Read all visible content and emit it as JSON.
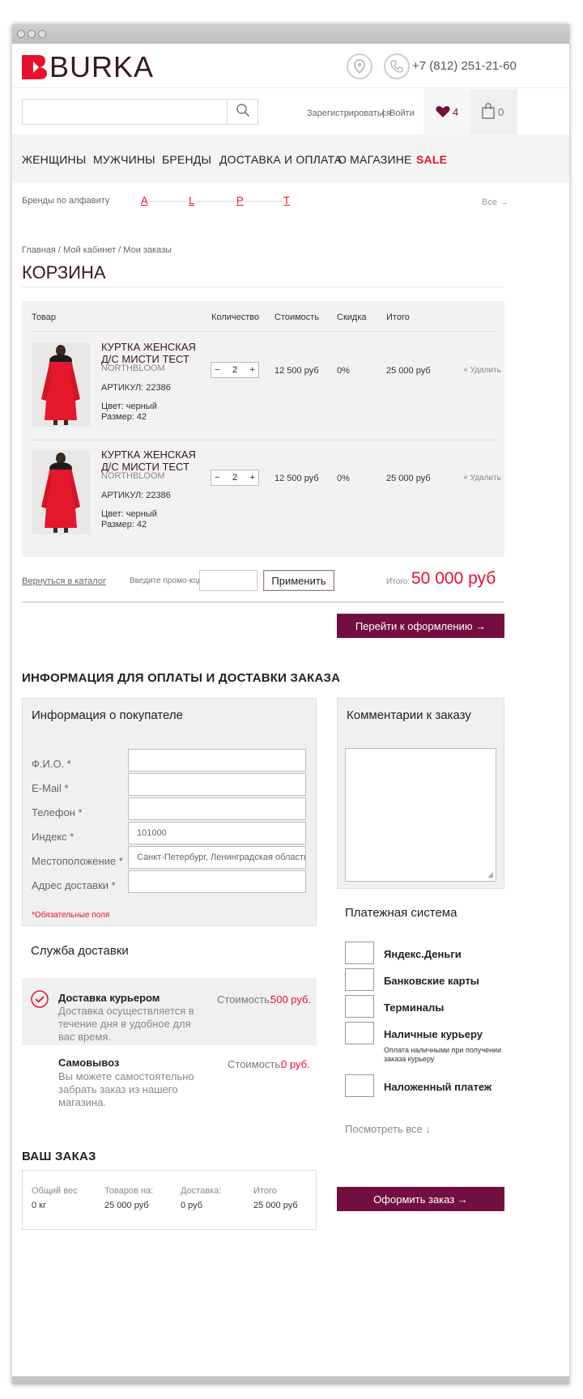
{
  "header": {
    "logo_text": "BURKA",
    "phone": "+7 (812) 251-21-60"
  },
  "topbar": {
    "search_placeholder": "",
    "register": "Зарегистрироваться",
    "separator": "|",
    "login": "Войти",
    "wishlist_count": "4",
    "cart_count": "0"
  },
  "nav": {
    "items": [
      "ЖЕНЩИНЫ",
      "МУЖЧИНЫ",
      "БРЕНДЫ",
      "ДОСТАВКА И ОПЛАТА",
      "О МАГАЗИНЕ"
    ],
    "sale": "SALE"
  },
  "brands_bar": {
    "label": "Бренды по алфавиту",
    "letters": [
      "A",
      "L",
      "P",
      "T"
    ],
    "all": "Все →"
  },
  "breadcrumbs": "Главная / Мой кабинет / Мои заказы",
  "page_title": "КОРЗИНА",
  "cart": {
    "headers": {
      "product": "Товар",
      "qty": "Количество",
      "price": "Стоимость",
      "discount": "Скидка",
      "total": "Итого"
    },
    "items": [
      {
        "name": "КУРТКА ЖЕНСКАЯ Д/С МИСТИ ТЕСТ",
        "brand": "NORTHBLOOM",
        "sku": "АРТИКУЛ: 22386",
        "color": "Цвет: черный",
        "size": "Размер: 42",
        "qty": "2",
        "price": "12 500 руб",
        "discount": "0%",
        "total": "25 000 руб",
        "remove": "× Удалить"
      },
      {
        "name": "КУРТКА ЖЕНСКАЯ Д/С МИСТИ ТЕСТ",
        "brand": "NORTHBLOOM",
        "sku": "АРТИКУЛ: 22386",
        "color": "Цвет: черный",
        "size": "Размер: 42",
        "qty": "2",
        "price": "12 500 руб",
        "discount": "0%",
        "total": "25 000 руб",
        "remove": "× Удалить"
      }
    ],
    "back_link": "Вернуться в каталог",
    "promo_label": "Введите промо-код",
    "promo_value": "",
    "apply": "Применить",
    "total_label": "Итого:",
    "total_value": "50 000 руб",
    "checkout": "Перейти к оформлению →"
  },
  "info": {
    "section_title": "ИНФОРМАЦИЯ ДЛЯ ОПЛАТЫ И ДОСТАВКИ ЗАКАЗА",
    "buyer_title": "Информация о покупателе",
    "fields": [
      {
        "label": "Ф.И.О. *",
        "value": ""
      },
      {
        "label": "E-Mail *",
        "value": ""
      },
      {
        "label": "Телефон *",
        "value": ""
      },
      {
        "label": "Индекс *",
        "value": "101000"
      },
      {
        "label": "Местоположение *",
        "value": "Санкт-Петербург, Ленинградская область, Рос"
      },
      {
        "label": "Адрес доставки *",
        "value": ""
      }
    ],
    "required_note": "*Обязательные поля",
    "comment_title": "Комментарии к заказу",
    "comment_value": ""
  },
  "delivery": {
    "title": "Служба доставки",
    "options": [
      {
        "name": "Доставка курьером",
        "desc": [
          "Доставка осуществляется в",
          "течение дня в удобное для",
          "вас время."
        ],
        "cost_label": "Стоимость:",
        "cost": "500 руб."
      },
      {
        "name": "Самовывоз",
        "desc": [
          "Вы можете самостоятельно",
          "забрать заказ из нашего",
          "магазина."
        ],
        "cost_label": "Стоимость:",
        "cost": "0 руб."
      }
    ]
  },
  "payment": {
    "title": "Платежная система",
    "options": [
      "Яндекс.Деньги",
      "Банковские карты",
      "Терминалы",
      "Наличные курьеру",
      "Наложенный платеж"
    ],
    "cash_note": [
      "Оплата наличными при получении",
      "заказа курьеру"
    ],
    "see_all": "Посмотреть все ↓"
  },
  "order": {
    "title": "ВАШ ЗАКАЗ",
    "cols": [
      {
        "label": "Общий вес",
        "value": "0 кг"
      },
      {
        "label": "Товаров на:",
        "value": "25 000 руб"
      },
      {
        "label": "Доставка:",
        "value": "0 руб"
      },
      {
        "label": "Итого",
        "value": "25 000 руб"
      }
    ],
    "submit": "Оформить заказ →"
  },
  "colors": {
    "accent": "#730f40",
    "sale": "#e8112d",
    "logo": "#e8112d"
  }
}
